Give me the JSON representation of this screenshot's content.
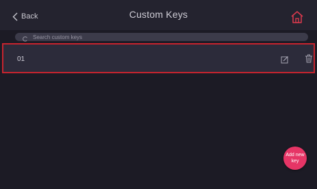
{
  "header": {
    "back_label": "Back",
    "title": "Custom Keys",
    "home_icon": "home-icon",
    "home_color": "#e03a4e"
  },
  "search": {
    "placeholder": "Search custom keys",
    "value": ""
  },
  "keys": [
    {
      "name": "01",
      "edit_icon": "edit-icon",
      "delete_icon": "trash-icon"
    }
  ],
  "add_button": {
    "label": "Add new key",
    "color": "#e63566"
  },
  "colors": {
    "background": "#1c1b25",
    "header": "#24232f",
    "row": "#2c2b3a",
    "selection_outline": "#c8242e"
  }
}
